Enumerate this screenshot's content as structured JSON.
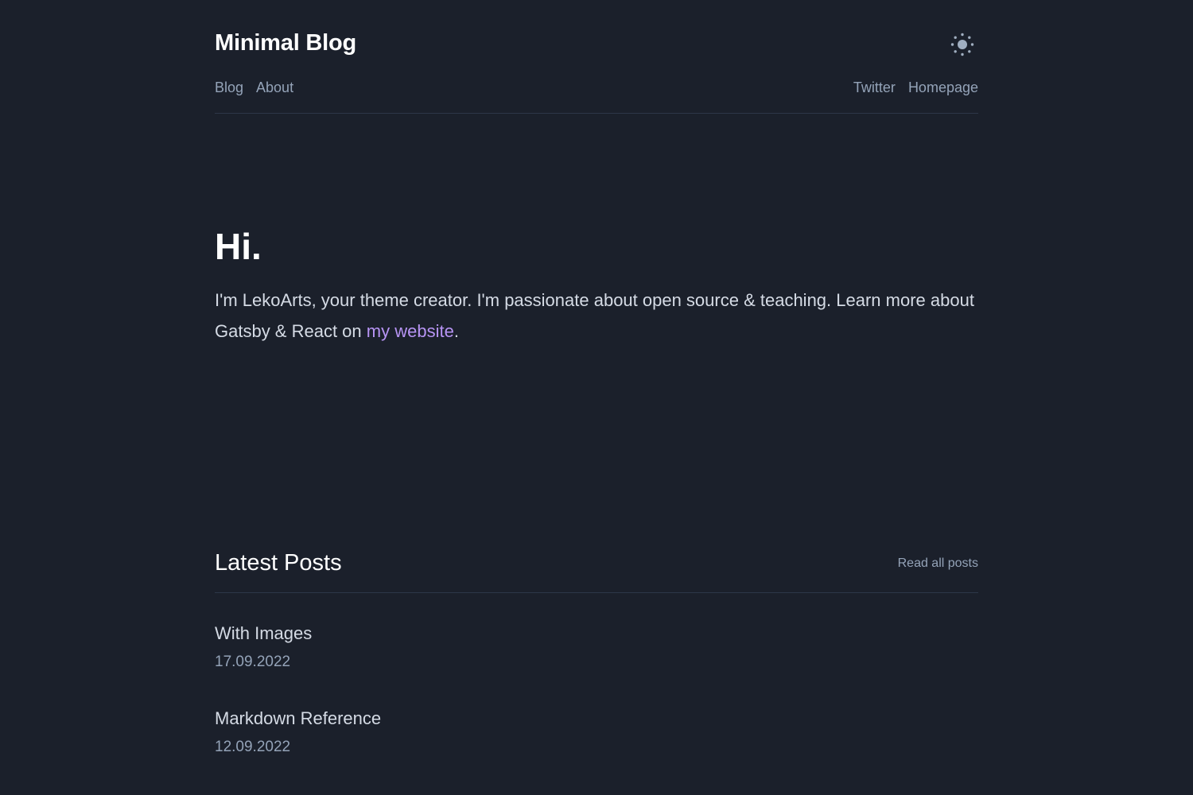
{
  "header": {
    "site_title": "Minimal Blog",
    "theme_toggle_icon": "sun-icon",
    "nav_left": [
      {
        "label": "Blog"
      },
      {
        "label": "About"
      }
    ],
    "nav_right": [
      {
        "label": "Twitter"
      },
      {
        "label": "Homepage"
      }
    ]
  },
  "hero": {
    "title": "Hi.",
    "text_before_link": "I'm LekoArts, your theme creator. I'm passionate about open source & teaching. Learn more about Gatsby & React on ",
    "link_label": "my website",
    "text_after_link": "."
  },
  "latest_posts": {
    "title": "Latest Posts",
    "read_all_label": "Read all posts",
    "posts": [
      {
        "title": "With Images",
        "date": "17.09.2022"
      },
      {
        "title": "Markdown Reference",
        "date": "12.09.2022"
      }
    ]
  },
  "colors": {
    "background": "#1b202b",
    "heading": "#ffffff",
    "text": "#d5dbe5",
    "muted": "#94a3b8",
    "link_accent": "#b794f4",
    "divider": "#2d3748"
  }
}
